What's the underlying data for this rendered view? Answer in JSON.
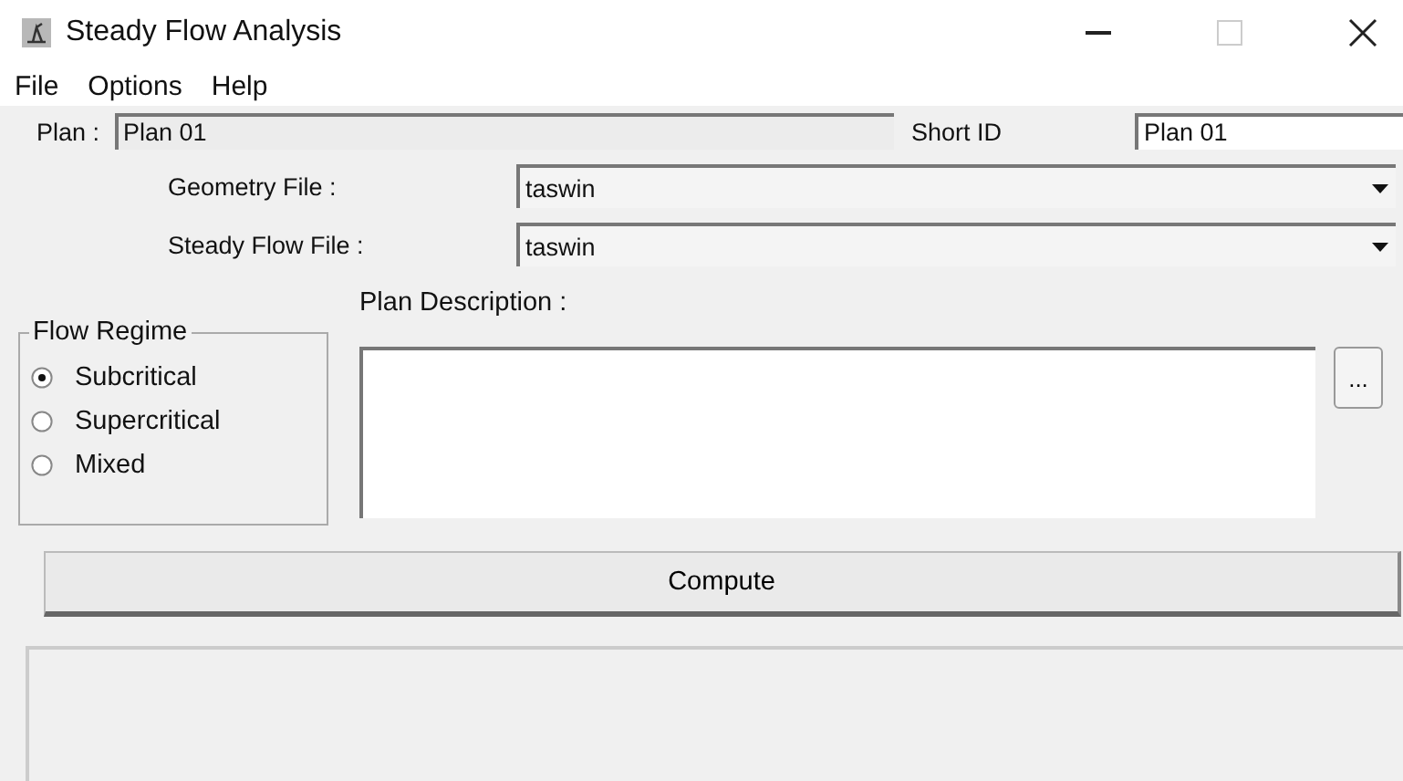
{
  "window": {
    "title": "Steady Flow Analysis"
  },
  "menu": [
    "File",
    "Options",
    "Help"
  ],
  "plan": {
    "label": "Plan :",
    "value": "Plan 01"
  },
  "short_id": {
    "label": "Short ID",
    "value": "Plan 01"
  },
  "files": [
    {
      "label": "Geometry File :",
      "value": "taswin"
    },
    {
      "label": "Steady Flow File :",
      "value": "taswin"
    }
  ],
  "flow_regime": {
    "title": "Flow Regime",
    "options": [
      {
        "label": "Subcritical",
        "selected": true
      },
      {
        "label": "Supercritical",
        "selected": false
      },
      {
        "label": "Mixed",
        "selected": false
      }
    ]
  },
  "description": {
    "label": "Plan Description :",
    "browse": "..."
  },
  "compute_button": "Compute"
}
